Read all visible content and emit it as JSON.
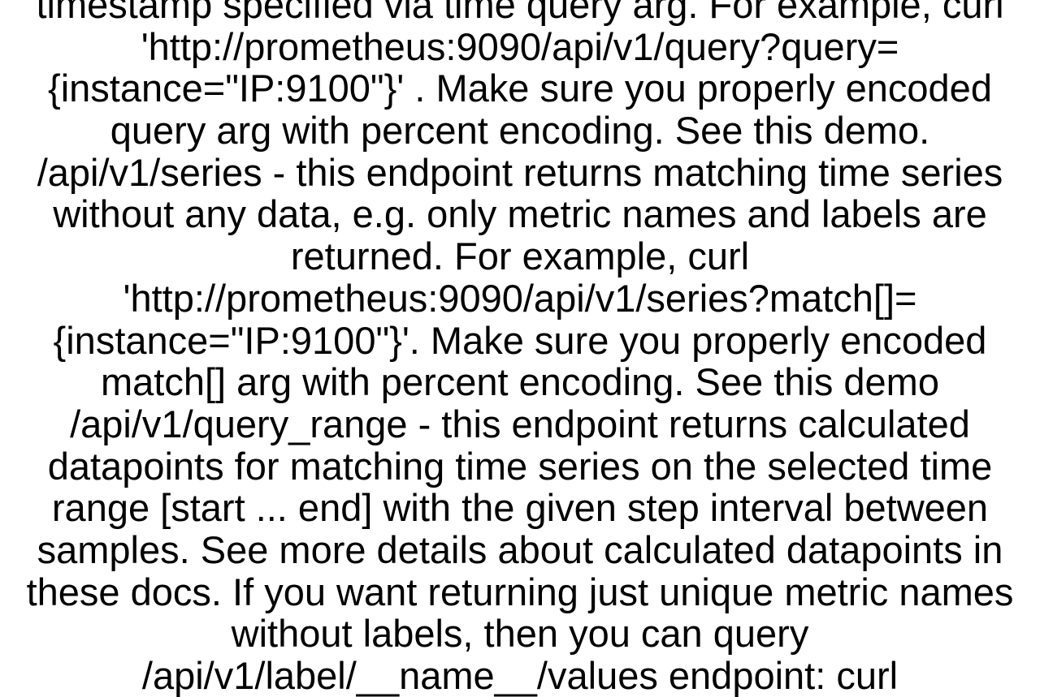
{
  "document": {
    "text": "timestamp specified via time query arg. For example, curl 'http://prometheus:9090/api/v1/query?query={instance=\"IP:9100\"}' . Make sure you properly encoded query arg with percent encoding. See this demo. /api/v1/series - this endpoint returns matching time series without any data, e.g. only metric names and labels are returned. For example, curl 'http://prometheus:9090/api/v1/series?match[]={instance=\"IP:9100\"}'. Make sure you properly encoded match[] arg with percent encoding. See this demo /api/v1/query_range - this endpoint returns calculated datapoints for matching time series on the selected time range [start ... end] with the given step interval between samples. See more details about calculated datapoints in these docs.  If you want returning just unique metric names without labels, then you can query /api/v1/label/__name__/values endpoint: curl"
  }
}
